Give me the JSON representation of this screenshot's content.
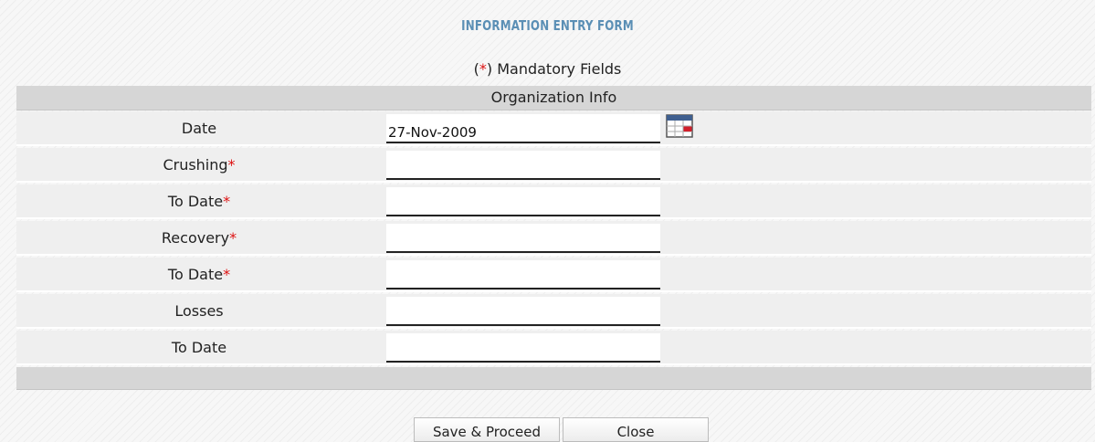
{
  "form": {
    "title": "INFORMATION ENTRY FORM",
    "mandatory_note": {
      "open": "(",
      "star": "*",
      "close": ") Mandatory Fields"
    },
    "section_title": "Organization Info"
  },
  "fields": [
    {
      "label": "Date",
      "required": "",
      "value": "27-Nov-2009"
    },
    {
      "label": "Crushing",
      "required": "*",
      "value": ""
    },
    {
      "label": "To Date",
      "required": "*",
      "value": ""
    },
    {
      "label": "Recovery",
      "required": "*",
      "value": ""
    },
    {
      "label": "To Date",
      "required": "*",
      "value": ""
    },
    {
      "label": "Losses",
      "required": "",
      "value": ""
    },
    {
      "label": "To Date",
      "required": "",
      "value": ""
    }
  ],
  "buttons": {
    "save": "Save & Proceed",
    "close": "Close"
  },
  "icons": {
    "date_picker": "calendar-icon"
  },
  "colors": {
    "title": "#5b8fb5",
    "required_star": "#dd1111",
    "band": "#d6d6d6",
    "row": "#efefef"
  }
}
